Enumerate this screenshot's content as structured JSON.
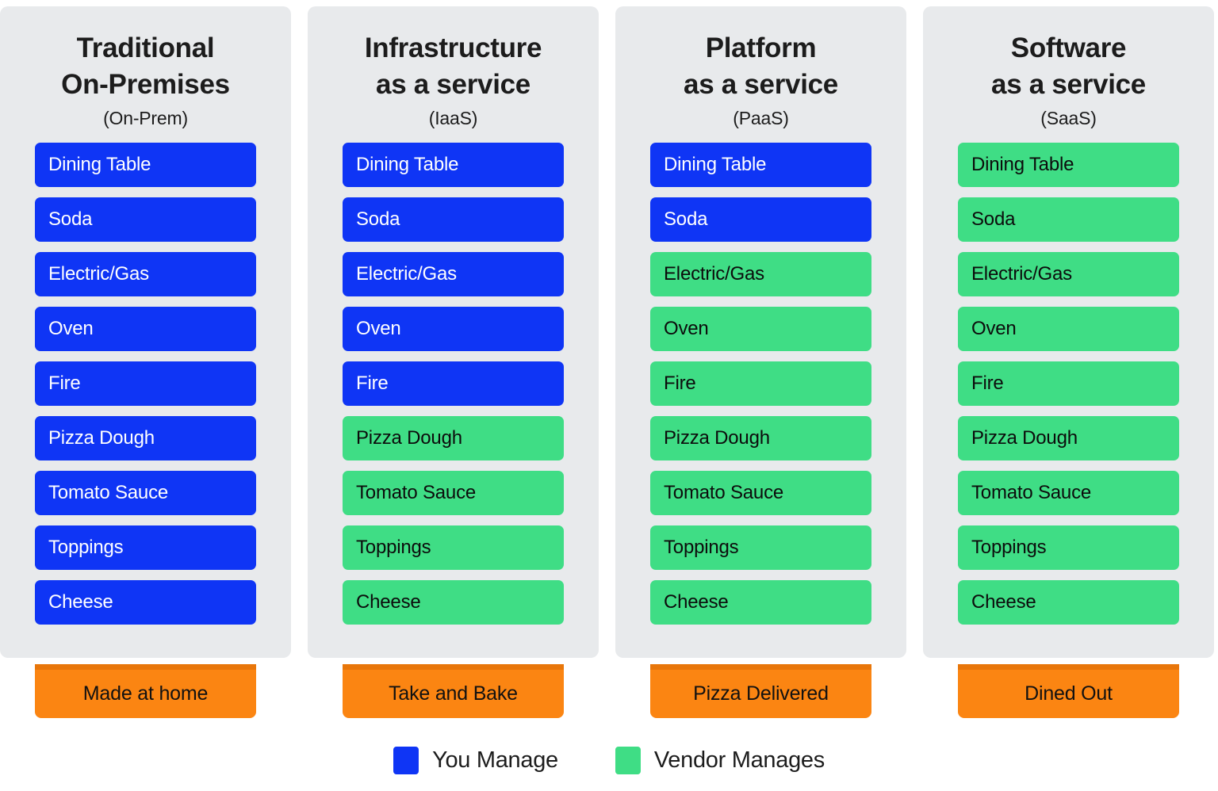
{
  "diagram": {
    "title_line_separator": "\n",
    "colors": {
      "you_manage": "#0f35f5",
      "vendor_manages": "#3fdd85",
      "outcome": "#fb8512",
      "card_background": "#e8eaec",
      "page_background": "#ffffff"
    },
    "row_labels": [
      "Dining Table",
      "Soda",
      "Electric/Gas",
      "Oven",
      "Fire",
      "Pizza Dough",
      "Tomato Sauce",
      "Toppings",
      "Cheese"
    ],
    "columns": [
      {
        "title_line1": "Traditional",
        "title_line2": "On-Premises",
        "subtitle": "(On-Prem)",
        "outcome": "Made at home",
        "rows": [
          {
            "label": "Dining Table",
            "owner": "you"
          },
          {
            "label": "Soda",
            "owner": "you"
          },
          {
            "label": "Electric/Gas",
            "owner": "you"
          },
          {
            "label": "Oven",
            "owner": "you"
          },
          {
            "label": "Fire",
            "owner": "you"
          },
          {
            "label": "Pizza Dough",
            "owner": "you"
          },
          {
            "label": "Tomato Sauce",
            "owner": "you"
          },
          {
            "label": "Toppings",
            "owner": "you"
          },
          {
            "label": "Cheese",
            "owner": "you"
          }
        ]
      },
      {
        "title_line1": "Infrastructure",
        "title_line2": "as a service",
        "subtitle": "(IaaS)",
        "outcome": "Take and Bake",
        "rows": [
          {
            "label": "Dining Table",
            "owner": "you"
          },
          {
            "label": "Soda",
            "owner": "you"
          },
          {
            "label": "Electric/Gas",
            "owner": "you"
          },
          {
            "label": "Oven",
            "owner": "you"
          },
          {
            "label": "Fire",
            "owner": "you"
          },
          {
            "label": "Pizza Dough",
            "owner": "vendor"
          },
          {
            "label": "Tomato Sauce",
            "owner": "vendor"
          },
          {
            "label": "Toppings",
            "owner": "vendor"
          },
          {
            "label": "Cheese",
            "owner": "vendor"
          }
        ]
      },
      {
        "title_line1": "Platform",
        "title_line2": "as a service",
        "subtitle": "(PaaS)",
        "outcome": "Pizza Delivered",
        "rows": [
          {
            "label": "Dining Table",
            "owner": "you"
          },
          {
            "label": "Soda",
            "owner": "you"
          },
          {
            "label": "Electric/Gas",
            "owner": "vendor"
          },
          {
            "label": "Oven",
            "owner": "vendor"
          },
          {
            "label": "Fire",
            "owner": "vendor"
          },
          {
            "label": "Pizza Dough",
            "owner": "vendor"
          },
          {
            "label": "Tomato Sauce",
            "owner": "vendor"
          },
          {
            "label": "Toppings",
            "owner": "vendor"
          },
          {
            "label": "Cheese",
            "owner": "vendor"
          }
        ]
      },
      {
        "title_line1": "Software",
        "title_line2": "as a service",
        "subtitle": "(SaaS)",
        "outcome": "Dined Out",
        "rows": [
          {
            "label": "Dining Table",
            "owner": "vendor"
          },
          {
            "label": "Soda",
            "owner": "vendor"
          },
          {
            "label": "Electric/Gas",
            "owner": "vendor"
          },
          {
            "label": "Oven",
            "owner": "vendor"
          },
          {
            "label": "Fire",
            "owner": "vendor"
          },
          {
            "label": "Pizza Dough",
            "owner": "vendor"
          },
          {
            "label": "Tomato Sauce",
            "owner": "vendor"
          },
          {
            "label": "Toppings",
            "owner": "vendor"
          },
          {
            "label": "Cheese",
            "owner": "vendor"
          }
        ]
      }
    ],
    "legend": [
      {
        "label": "You Manage",
        "owner": "you"
      },
      {
        "label": "Vendor Manages",
        "owner": "vendor"
      }
    ]
  }
}
